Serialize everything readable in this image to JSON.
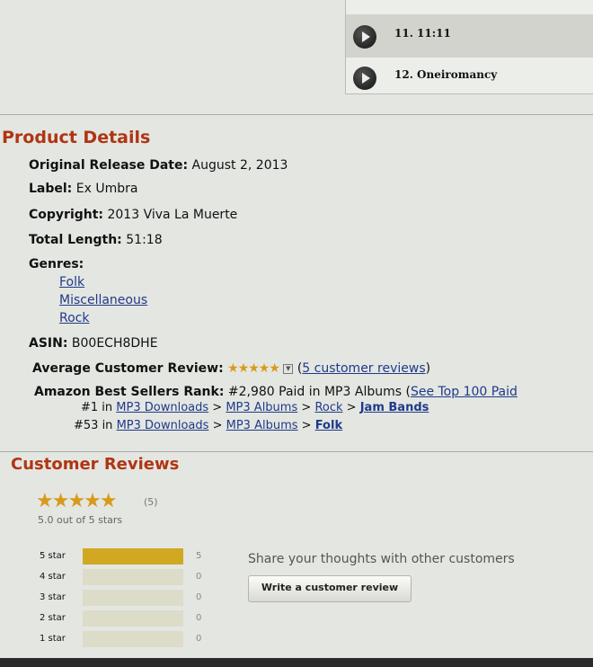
{
  "tracks": [
    {
      "label": "11. 11:11"
    },
    {
      "label": "12. Oneiromancy"
    }
  ],
  "product_details": {
    "title": "Product Details",
    "release": {
      "label": "Original Release Date:",
      "value": "August 2, 2013"
    },
    "label": {
      "label": "Label:",
      "value": "Ex Umbra"
    },
    "copyright": {
      "label": "Copyright:",
      "value": "2013 Viva La Muerte"
    },
    "length": {
      "label": "Total Length:",
      "value": "51:18"
    },
    "genres": {
      "label": "Genres:",
      "items": [
        "Folk",
        "Miscellaneous",
        "Rock"
      ]
    },
    "asin": {
      "label": "ASIN:",
      "value": "B00ECH8DHE"
    },
    "avg_review": {
      "label": "Average Customer Review:",
      "stars": "★★★★★",
      "link": "5 customer reviews",
      "paren_open": "(",
      "paren_close": ")"
    },
    "rank": {
      "label": "Amazon Best Sellers Rank:",
      "value": "#2,980 Paid in MP3 Albums (",
      "link": "See Top 100 Paid",
      "sub1": {
        "prefix": "#1 in",
        "path": [
          "MP3 Downloads",
          "MP3 Albums",
          "Rock"
        ],
        "leaf": "Jam Bands"
      },
      "sub2": {
        "prefix": "#53 in",
        "path": [
          "MP3 Downloads",
          "MP3 Albums"
        ],
        "leaf": "Folk"
      },
      "sep": ">"
    }
  },
  "customer_reviews": {
    "title": "Customer Reviews",
    "stars": "★★★★★",
    "count": "(5)",
    "out_of": "5.0 out of 5 stars",
    "histogram": [
      {
        "label": "5 star",
        "count": "5",
        "fraction": 1.0
      },
      {
        "label": "4 star",
        "count": "0",
        "fraction": 0
      },
      {
        "label": "3 star",
        "count": "0",
        "fraction": 0
      },
      {
        "label": "2 star",
        "count": "0",
        "fraction": 0
      },
      {
        "label": "1 star",
        "count": "0",
        "fraction": 0
      }
    ],
    "share_text": "Share your thoughts with other customers",
    "write_button": "Write a customer review"
  },
  "colors": {
    "heading": "#b03512",
    "link": "#1f3a8a",
    "star": "#d99a1a",
    "bar_fill": "#d1a822"
  }
}
